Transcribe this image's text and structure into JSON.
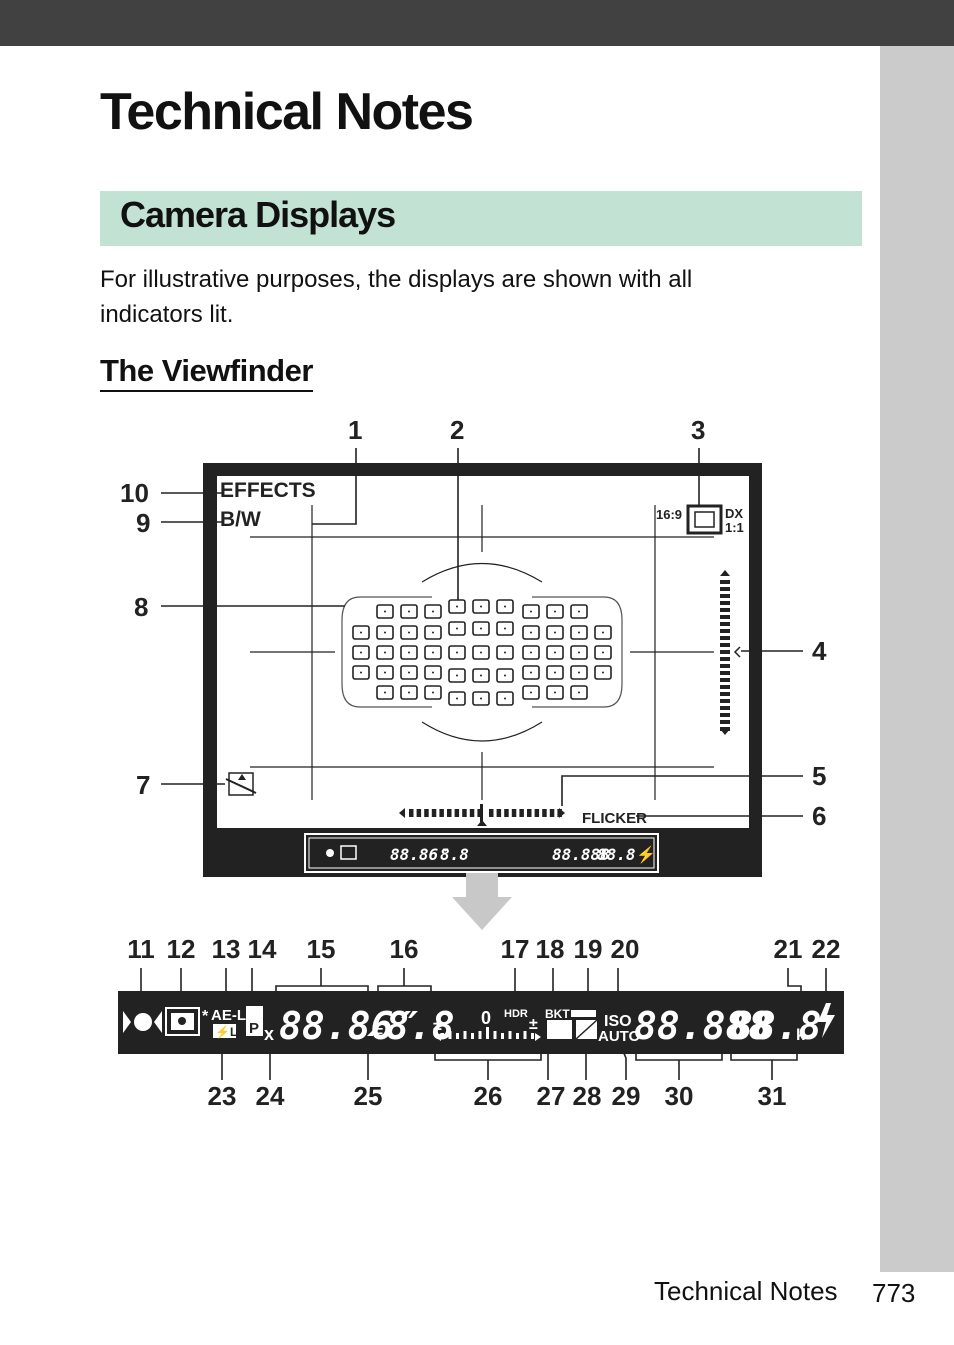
{
  "page": {
    "title": "Technical Notes",
    "section": "Camera Displays",
    "intro": "For illustrative purposes, the displays are shown with all indicators lit.",
    "subheading": "The Viewfinder",
    "footer": {
      "section": "Technical Notes",
      "page_number": "773"
    },
    "colors": {
      "topbar": "#414141",
      "side_tab": "#cbcbcb",
      "section_band": "#c2e2d4",
      "arrow": "#c8c8c8"
    }
  },
  "viewfinder": {
    "effects_label": "EFFECTS",
    "bw_label": "B/W",
    "aspect_label": "16:9",
    "dx_label": "DX",
    "ratio_label": "1:1",
    "flicker_label": "FLICKER",
    "focus_point_rows": [
      3,
      4,
      4,
      4,
      3
    ]
  },
  "info_display": {
    "ael_label": "AE-L",
    "fl_label": "⚡L",
    "star": "*",
    "p_label": "P",
    "x_label": "x",
    "shutter_digits": "88.86″",
    "f_label": "F",
    "aperture_digits": "8.8",
    "zero_label": "0",
    "hdr_label": "HDR",
    "bkt_label": "BKT",
    "iso_label": "ISO",
    "auto_label": "AUTO",
    "iso_digits": "88.888",
    "count_digits": "88.8",
    "k_label": "k",
    "flash_icon": "⚡"
  },
  "callouts_top": [
    "1",
    "2",
    "3"
  ],
  "callouts_left": [
    "10",
    "9",
    "8",
    "7"
  ],
  "callouts_right": [
    "4",
    "5",
    "6"
  ],
  "callouts_display_top": [
    "11",
    "12",
    "13",
    "14",
    "15",
    "16",
    "17",
    "18",
    "19",
    "20",
    "21",
    "22"
  ],
  "callouts_display_bottom": [
    "23",
    "24",
    "25",
    "26",
    "27",
    "28",
    "29",
    "30",
    "31"
  ]
}
